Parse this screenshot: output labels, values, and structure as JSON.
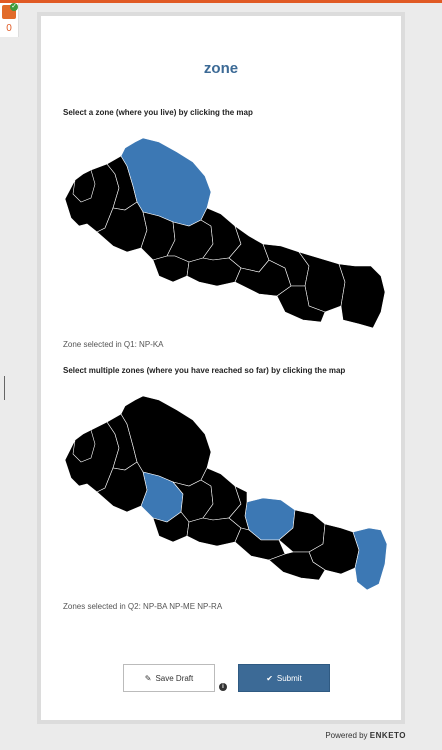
{
  "form": {
    "title": "zone",
    "q1": {
      "label": "Select a zone (where you live) by clicking the map",
      "result": "Zone selected in Q1: NP-KA"
    },
    "q2": {
      "label": "Select multiple zones (where you have reached so far) by clicking the map",
      "result": "Zones selected in Q2: NP-BA NP-ME NP-RA"
    }
  },
  "buttons": {
    "save_draft_label": "Save Draft",
    "submit_label": "Submit"
  },
  "footer": {
    "powered_by": "Powered by",
    "brand": "ENKETO"
  },
  "widget": {
    "count": "0"
  },
  "colors": {
    "accent": "#3c6a96",
    "selected_zone": "#3c78b4",
    "zone": "#000000",
    "topbar": "#e05a24"
  },
  "icons": {
    "draft": "pencil-icon",
    "submit": "check-icon",
    "info": "info-icon"
  }
}
